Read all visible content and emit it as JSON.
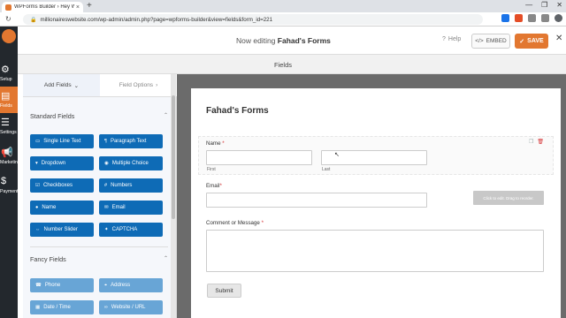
{
  "browser": {
    "tab_title": "WPForms Builder › Hey Wordpre",
    "tab_close": "×",
    "new_tab": "+",
    "url": "millionaireswebsite.com/wp-admin/admin.php?page=wpforms-builder&view=fields&form_id=221",
    "window_controls": [
      "—",
      "❐",
      "✕"
    ]
  },
  "wp_menu": {
    "items": [
      {
        "label": "Setup",
        "icon": "gear-icon"
      },
      {
        "label": "Fields",
        "icon": "fields-icon"
      },
      {
        "label": "Settings",
        "icon": "sliders-icon"
      },
      {
        "label": "Marketing",
        "icon": "megaphone-icon"
      },
      {
        "label": "Payments",
        "icon": "dollar-icon"
      }
    ]
  },
  "toolbar": {
    "title_prefix": "Now editing ",
    "title_form": "Fahad's Forms",
    "help_label": "Help",
    "embed_label": "EMBED",
    "save_label": "SAVE",
    "close": "✕"
  },
  "subheader": {
    "label": "Fields"
  },
  "sidebar": {
    "tabs": [
      {
        "label": "Add Fields",
        "chevron": "⌄"
      },
      {
        "label": "Field Options",
        "chevron": "›"
      }
    ],
    "standard": {
      "title": "Standard Fields",
      "chevron": "⌃",
      "fields": [
        {
          "label": "Single Line Text",
          "icon": "text-icon"
        },
        {
          "label": "Paragraph Text",
          "icon": "paragraph-icon"
        },
        {
          "label": "Dropdown",
          "icon": "dropdown-icon"
        },
        {
          "label": "Multiple Choice",
          "icon": "radio-icon"
        },
        {
          "label": "Checkboxes",
          "icon": "checkbox-icon"
        },
        {
          "label": "Numbers",
          "icon": "hash-icon"
        },
        {
          "label": "Name",
          "icon": "user-icon"
        },
        {
          "label": "Email",
          "icon": "envelope-icon"
        },
        {
          "label": "Number Slider",
          "icon": "slider-icon"
        },
        {
          "label": "CAPTCHA",
          "icon": "captcha-icon"
        }
      ]
    },
    "fancy": {
      "title": "Fancy Fields",
      "chevron": "⌃",
      "fields": [
        {
          "label": "Phone",
          "icon": "phone-icon"
        },
        {
          "label": "Address",
          "icon": "map-pin-icon"
        },
        {
          "label": "Date / Time",
          "icon": "calendar-icon"
        },
        {
          "label": "Website / URL",
          "icon": "link-icon"
        }
      ]
    }
  },
  "form": {
    "title": "Fahad's Forms",
    "name_label": "Name",
    "name_first": "First",
    "name_last": "Last",
    "email_label": "Email",
    "message_label": "Comment or Message",
    "required_mark": "*",
    "helper_text": "Click to edit. Drag to reorder.",
    "submit_label": "Submit"
  }
}
